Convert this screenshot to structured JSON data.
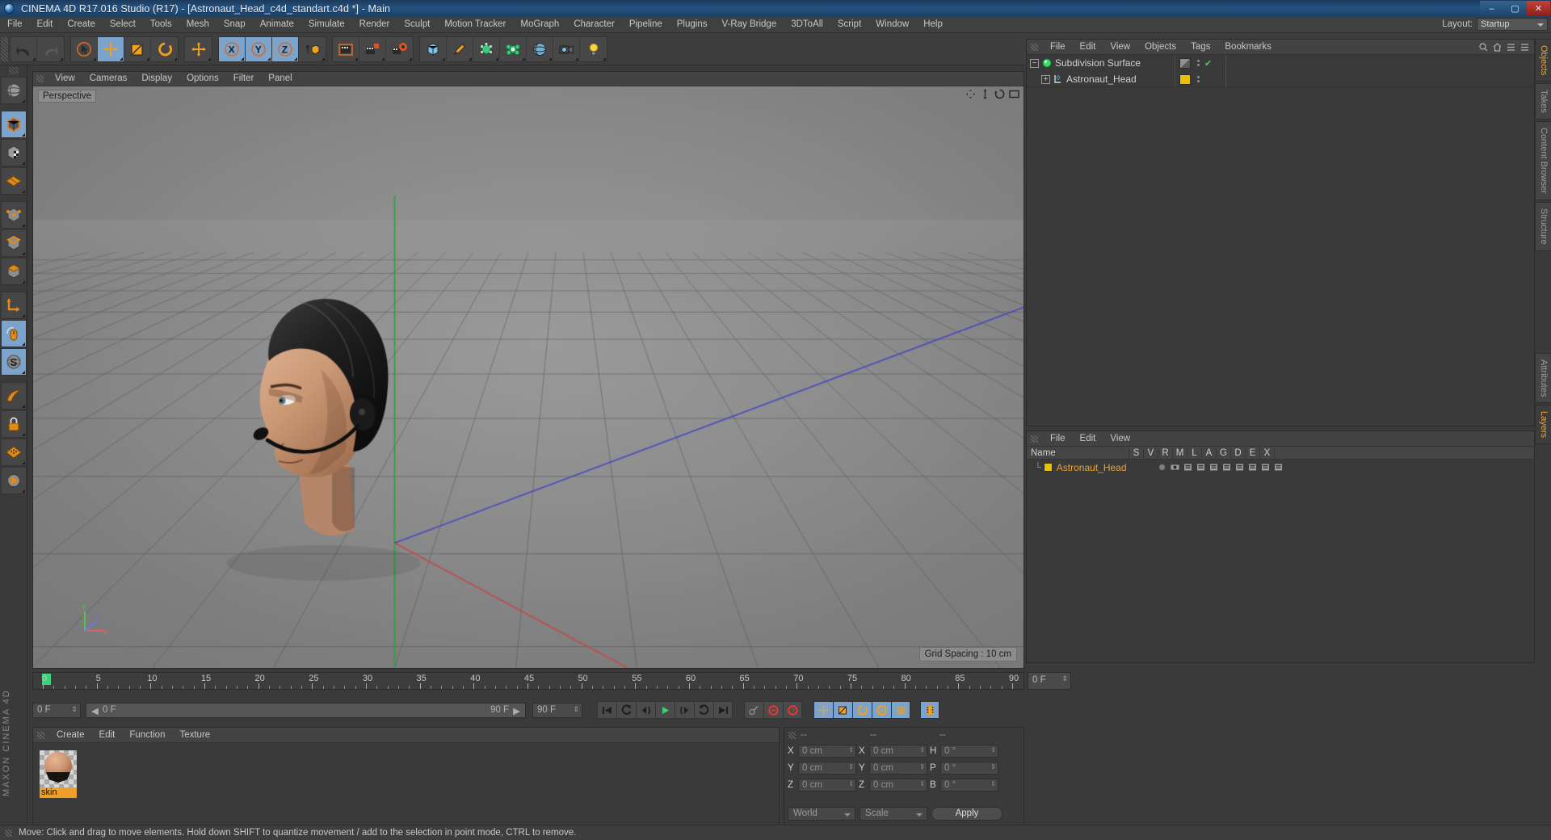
{
  "window": {
    "title": "CINEMA 4D R17.016 Studio (R17) - [Astronaut_Head_c4d_standart.c4d *] - Main",
    "minimize": "–",
    "maximize": "▢",
    "close": "✕"
  },
  "menubar": {
    "items": [
      "File",
      "Edit",
      "Create",
      "Select",
      "Tools",
      "Mesh",
      "Snap",
      "Animate",
      "Simulate",
      "Render",
      "Sculpt",
      "Motion Tracker",
      "MoGraph",
      "Character",
      "Pipeline",
      "Plugins",
      "V-Ray Bridge",
      "3DToAll",
      "Script",
      "Window",
      "Help"
    ],
    "layout_label": "Layout:",
    "layout_value": "Startup"
  },
  "toolbar": {
    "groups": [
      {
        "name": "history",
        "buttons": [
          {
            "name": "undo-button",
            "icon": "undo-icon",
            "active": false
          },
          {
            "name": "redo-button",
            "icon": "redo-icon",
            "active": false
          }
        ]
      },
      {
        "name": "transform",
        "buttons": [
          {
            "name": "select-tool-button",
            "icon": "cursor-select-icon",
            "active": false
          },
          {
            "name": "move-tool-button",
            "icon": "move-arrows-icon",
            "active": true
          },
          {
            "name": "scale-tool-button",
            "icon": "scale-box-icon",
            "active": false
          },
          {
            "name": "rotate-tool-button",
            "icon": "rotate-circle-icon",
            "active": false
          }
        ]
      },
      {
        "name": "world-move",
        "buttons": [
          {
            "name": "world-move-button",
            "icon": "move-arrows-icon",
            "active": false
          }
        ]
      },
      {
        "name": "axis-locks",
        "buttons": [
          {
            "name": "lock-x-axis-button",
            "icon": "axis-x-icon",
            "active": true
          },
          {
            "name": "lock-y-axis-button",
            "icon": "axis-y-icon",
            "active": true
          },
          {
            "name": "lock-z-axis-button",
            "icon": "axis-z-icon",
            "active": true
          },
          {
            "name": "world-object-coordinates-button",
            "icon": "world-cube-icon",
            "active": false
          }
        ]
      },
      {
        "name": "render",
        "buttons": [
          {
            "name": "render-view-button",
            "icon": "clapper-frame-icon",
            "active": false
          },
          {
            "name": "render-to-picture-viewer-button",
            "icon": "clapper-render-icon",
            "active": false
          },
          {
            "name": "render-settings-button",
            "icon": "clapper-gear-icon",
            "active": false
          }
        ]
      },
      {
        "name": "create",
        "buttons": [
          {
            "name": "add-cube-button",
            "icon": "cube-icon",
            "active": false
          },
          {
            "name": "add-spline-button",
            "icon": "pen-icon",
            "active": false
          },
          {
            "name": "add-generator-button",
            "icon": "generator-icon",
            "active": false
          },
          {
            "name": "add-deformer-button",
            "icon": "deformer-icon",
            "active": false
          },
          {
            "name": "add-scene-object-button",
            "icon": "environment-icon",
            "active": false
          },
          {
            "name": "add-camera-button",
            "icon": "camera-icon",
            "active": false
          },
          {
            "name": "add-light-button",
            "icon": "light-bulb-icon",
            "active": false
          }
        ]
      }
    ]
  },
  "left_palette": {
    "items": [
      {
        "name": "live-selection-tool",
        "icon": "globe-wire-icon",
        "active": false
      },
      {
        "name": "model-mode-tool",
        "icon": "model-cube-icon",
        "active": true
      },
      {
        "name": "texture-mode-tool",
        "icon": "texture-cube-icon",
        "active": false
      },
      {
        "name": "workplane-tool",
        "icon": "workplane-grid-icon",
        "active": false
      },
      {
        "name": "points-mode-tool",
        "icon": "points-cube-icon",
        "active": false
      },
      {
        "name": "edges-mode-tool",
        "icon": "edges-cube-icon",
        "active": false
      },
      {
        "name": "polygons-mode-tool",
        "icon": "polygons-cube-icon",
        "active": false
      },
      {
        "name": "axis-mode-tool",
        "icon": "axis-l-icon",
        "active": false
      },
      {
        "name": "enable-snap-tool",
        "icon": "mouse-icon",
        "active": true
      },
      {
        "name": "soft-selection-tool",
        "icon": "s-sphere-icon",
        "active": true
      },
      {
        "name": "viewport-solo-tool",
        "icon": "solo-swoosh-icon",
        "active": false
      },
      {
        "name": "texture-lock-tool",
        "icon": "lock-icon",
        "active": false
      },
      {
        "name": "layer-tool",
        "icon": "layer-dots-icon",
        "active": false
      },
      {
        "name": "animate-tool",
        "icon": "animate-icon",
        "active": false
      }
    ]
  },
  "viewport": {
    "menu": [
      "View",
      "Cameras",
      "Display",
      "Options",
      "Filter",
      "Panel"
    ],
    "label": "Perspective",
    "grid_spacing": "Grid Spacing : 10 cm",
    "axis_labels": {
      "y": "Y",
      "z": "Z",
      "x": "X"
    }
  },
  "object_manager": {
    "menu": [
      "File",
      "Edit",
      "View",
      "Objects",
      "Tags",
      "Bookmarks"
    ],
    "objects": [
      {
        "name": "Subdivision Surface",
        "icon": "subdivision-surface-icon",
        "tag": "display-tag",
        "check": "✔",
        "level": 0
      },
      {
        "name": "Astronaut_Head",
        "icon": "polygon-object-icon",
        "tag": "material-tag",
        "check": "",
        "level": 1
      }
    ]
  },
  "layer_manager": {
    "menu": [
      "File",
      "Edit",
      "View"
    ],
    "columns": [
      "Name",
      "S",
      "V",
      "R",
      "M",
      "L",
      "A",
      "G",
      "D",
      "E",
      "X"
    ],
    "rows": [
      {
        "name": "Astronaut_Head",
        "color": "#f0c000"
      }
    ]
  },
  "right_tabs": [
    {
      "label": "Objects",
      "selected": true
    },
    {
      "label": "Takes",
      "selected": false
    },
    {
      "label": "Content Browser",
      "selected": false
    },
    {
      "label": "Structure",
      "selected": false
    },
    {
      "label": "Attributes",
      "selected": false
    },
    {
      "label": "Layers",
      "selected": true
    }
  ],
  "timeline": {
    "ticks": [
      "0",
      "5",
      "10",
      "15",
      "20",
      "25",
      "30",
      "35",
      "40",
      "45",
      "50",
      "55",
      "60",
      "65",
      "70",
      "75",
      "80",
      "85",
      "90"
    ],
    "start_value": "0 F",
    "end_value": "90 F",
    "current_frame": "0 F",
    "range_start": "0 F",
    "range_end": "90 F",
    "preview_end": "90 F"
  },
  "transport": {
    "buttons": [
      {
        "name": "go-to-start-button",
        "icon": "skip-start-icon",
        "active": false
      },
      {
        "name": "previous-keyframe-button",
        "icon": "prev-key-icon",
        "active": false
      },
      {
        "name": "step-back-button",
        "icon": "step-back-icon",
        "active": false
      },
      {
        "name": "play-button",
        "icon": "play-icon",
        "active": false
      },
      {
        "name": "step-forward-button",
        "icon": "step-forward-icon",
        "active": false
      },
      {
        "name": "next-keyframe-button",
        "icon": "next-key-icon",
        "active": false
      },
      {
        "name": "go-to-end-button",
        "icon": "skip-end-icon",
        "active": false
      }
    ],
    "record_group": [
      {
        "name": "autokey-button",
        "icon": "key-icon",
        "active": false
      },
      {
        "name": "record-active-objects-button",
        "icon": "record-circle-icon",
        "active": false
      },
      {
        "name": "keyframe-selection-button",
        "icon": "question-circle-icon",
        "active": false
      }
    ],
    "param_group": [
      {
        "name": "record-position-button",
        "icon": "move-arrows-icon",
        "active": true
      },
      {
        "name": "record-scale-button",
        "icon": "scale-box-icon",
        "active": true
      },
      {
        "name": "record-rotation-button",
        "icon": "rotate-circle-icon",
        "active": true
      },
      {
        "name": "record-pla-button",
        "icon": "p-circle-icon",
        "active": true
      },
      {
        "name": "record-points-button",
        "icon": "dots-grid-icon",
        "active": true
      }
    ],
    "timeline_toggle": {
      "name": "timeline-button",
      "icon": "film-strip-icon",
      "active": true
    }
  },
  "material_manager": {
    "menu": [
      "Create",
      "Edit",
      "Function",
      "Texture"
    ],
    "materials": [
      {
        "name": "skin"
      }
    ]
  },
  "coordinates": {
    "header": [
      "--",
      "--",
      "--"
    ],
    "rows": [
      {
        "axis1": "X",
        "val1": "0 cm",
        "axis2": "X",
        "val2": "0 cm",
        "axis3": "H",
        "val3": "0 °"
      },
      {
        "axis1": "Y",
        "val1": "0 cm",
        "axis2": "Y",
        "val2": "0 cm",
        "axis3": "P",
        "val3": "0 °"
      },
      {
        "axis1": "Z",
        "val1": "0 cm",
        "axis2": "Z",
        "val2": "0 cm",
        "axis3": "B",
        "val3": "0 °"
      }
    ],
    "system": "World",
    "mode": "Scale",
    "apply": "Apply"
  },
  "status": {
    "text": "Move: Click and drag to move elements. Hold down SHIFT to quantize movement / add to the selection in point mode, CTRL to remove."
  },
  "branding": {
    "maxon": "MAXON CINEMA 4D"
  },
  "colors": {
    "accent": "#e8a33d",
    "active_button": "#7ba3cc",
    "panel_bg": "#3a3a3a",
    "title_blue": "#24527f"
  }
}
